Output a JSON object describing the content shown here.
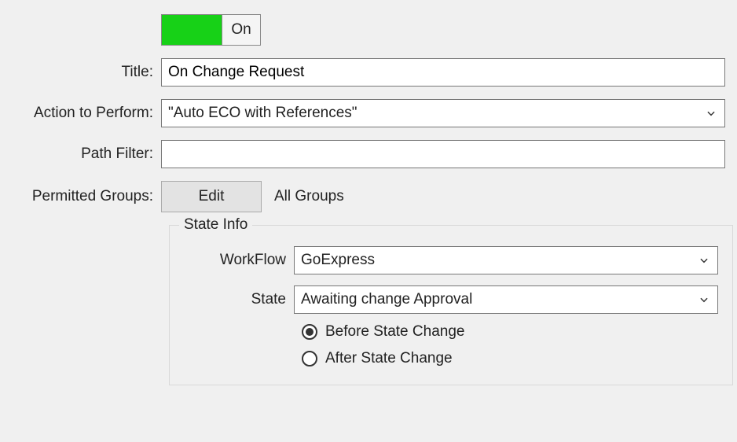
{
  "toggle": {
    "state": "On"
  },
  "fields": {
    "title_label": "Title:",
    "title_value": "On Change Request",
    "action_label": "Action to Perform:",
    "action_value": "\"Auto ECO with References\"",
    "path_filter_label": "Path Filter:",
    "path_filter_value": "",
    "permitted_groups_label": "Permitted Groups:",
    "edit_button": "Edit",
    "groups_display": "All Groups"
  },
  "state_info": {
    "legend": "State Info",
    "workflow_label": "WorkFlow",
    "workflow_value": "GoExpress",
    "state_label": "State",
    "state_value": "Awaiting change Approval",
    "radio_before": "Before State Change",
    "radio_after": "After State Change",
    "selected_radio": "before"
  }
}
